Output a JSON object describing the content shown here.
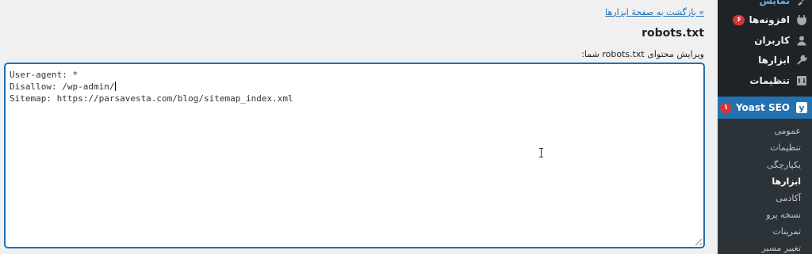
{
  "content": {
    "back_link": "» بازگشت به صفحهٔ ابزارها",
    "page_title": "robots.txt",
    "edit_label": "ویرایش محتوای robots.txt شما:",
    "editor_lines": [
      "User-agent: *",
      "Disallow: /wp-admin/",
      "Sitemap: https://parsavesta.com/blog/sitemap_index.xml"
    ]
  },
  "sidebar": {
    "top_partial": "نمایش",
    "items": [
      {
        "label": "افزونه‌ها",
        "icon": "plugin-icon",
        "badge": "۶"
      },
      {
        "label": "کاربران",
        "icon": "user-icon"
      },
      {
        "label": "ابزارها",
        "icon": "wrench-icon"
      },
      {
        "label": "تنظیمات",
        "icon": "settings-icon"
      }
    ],
    "active": {
      "label": "Yoast SEO",
      "badge": "۱",
      "icon": "yoast-icon"
    },
    "submenu": [
      "عمومی",
      "تنظیمات",
      "یکپارچگی",
      "ابزارها",
      "آکادمی",
      "نسخه پرو",
      "تمرینات",
      "تغییر مسیر"
    ],
    "submenu_current": "ابزارها"
  },
  "colors": {
    "sidebar_bg": "#1d2327",
    "submenu_bg": "#2c3338",
    "accent": "#2271b1",
    "badge": "#d63638",
    "page_bg": "#f0f0f1"
  }
}
